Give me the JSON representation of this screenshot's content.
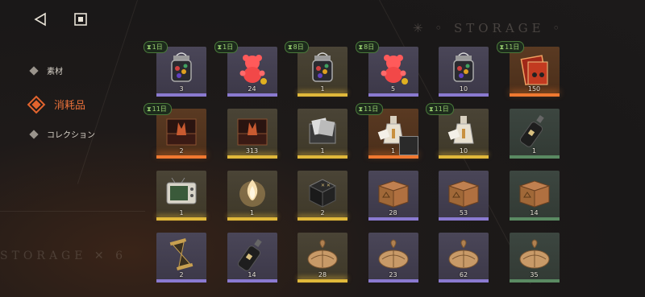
{
  "header": {
    "back_icon": "back-triangle-icon",
    "home_icon": "stop-square-icon"
  },
  "decor": {
    "storage_top": "✳ ◦ STORAGE ◦",
    "storage_bottom": "STORAGE ✕ 6"
  },
  "nav": {
    "items": [
      {
        "label": "素材",
        "active": false
      },
      {
        "label": "消耗品",
        "active": true
      },
      {
        "label": "コレクション",
        "active": false
      }
    ]
  },
  "colors": {
    "accent": "#e2642e",
    "purple": "#8a7ad0",
    "gold": "#e0b83a",
    "orange": "#f07830",
    "green": "#5a8a62",
    "timer": "#9ad070"
  },
  "items": [
    {
      "name": "candy-jar",
      "qty": "3",
      "rarity": "purple",
      "timer": "1日"
    },
    {
      "name": "gummy-bear",
      "qty": "24",
      "rarity": "purple",
      "timer": "1日"
    },
    {
      "name": "candy-jar",
      "qty": "1",
      "rarity": "gold",
      "timer": "8日"
    },
    {
      "name": "gummy-bear",
      "qty": "5",
      "rarity": "purple",
      "timer": "8日"
    },
    {
      "name": "candy-jar",
      "qty": "10",
      "rarity": "purple",
      "timer": ""
    },
    {
      "name": "cassette-box",
      "qty": "150",
      "rarity": "orange",
      "timer": "11日"
    },
    {
      "name": "fox-music-box",
      "qty": "2",
      "rarity": "orange",
      "timer": "11日"
    },
    {
      "name": "fox-music-box",
      "qty": "313",
      "rarity": "gold",
      "timer": ""
    },
    {
      "name": "photo-box",
      "qty": "1",
      "rarity": "gold",
      "timer": ""
    },
    {
      "name": "letter-vase",
      "qty": "1",
      "rarity": "orange",
      "timer": "11日"
    },
    {
      "name": "letter-vase",
      "qty": "10",
      "rarity": "gold",
      "timer": "11日"
    },
    {
      "name": "dark-bottle",
      "qty": "1",
      "rarity": "green",
      "timer": ""
    },
    {
      "name": "old-tv",
      "qty": "1",
      "rarity": "gold",
      "timer": ""
    },
    {
      "name": "glowing-flame",
      "qty": "1",
      "rarity": "gold",
      "timer": ""
    },
    {
      "name": "dark-chest",
      "qty": "2",
      "rarity": "gold",
      "timer": ""
    },
    {
      "name": "wooden-crate",
      "qty": "28",
      "rarity": "purple",
      "timer": ""
    },
    {
      "name": "wooden-crate",
      "qty": "53",
      "rarity": "purple",
      "timer": ""
    },
    {
      "name": "wooden-crate",
      "qty": "14",
      "rarity": "green",
      "timer": ""
    },
    {
      "name": "hourglass",
      "qty": "2",
      "rarity": "purple",
      "timer": ""
    },
    {
      "name": "dark-bottle",
      "qty": "14",
      "rarity": "purple",
      "timer": ""
    },
    {
      "name": "cloth-sack",
      "qty": "28",
      "rarity": "gold",
      "timer": ""
    },
    {
      "name": "cloth-sack",
      "qty": "23",
      "rarity": "purple",
      "timer": ""
    },
    {
      "name": "cloth-sack",
      "qty": "62",
      "rarity": "purple",
      "timer": ""
    },
    {
      "name": "cloth-sack",
      "qty": "35",
      "rarity": "green",
      "timer": ""
    }
  ]
}
